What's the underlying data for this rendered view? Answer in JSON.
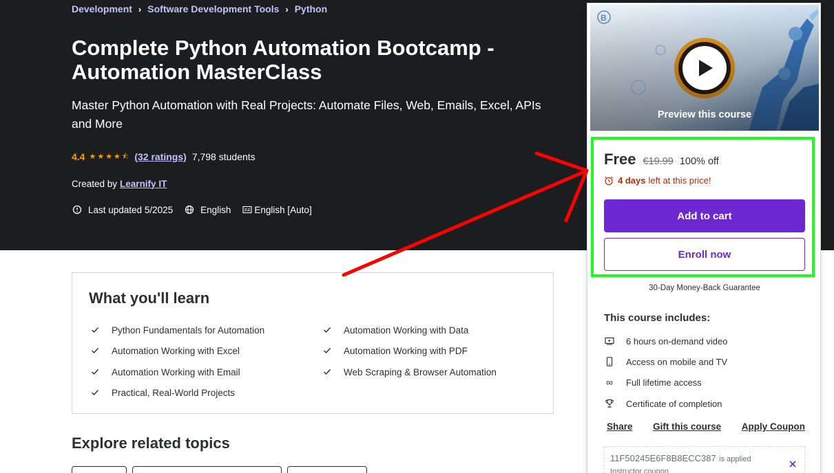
{
  "breadcrumb": [
    "Development",
    "Software Development Tools",
    "Python"
  ],
  "course": {
    "title": "Complete Python Automation Bootcamp - Automation MasterClass",
    "subtitle": "Master Python Automation with Real Projects: Automate Files, Web, Emails, Excel, APIs and More",
    "rating": "4.4",
    "stars_value": 4.4,
    "ratings_link": "(32 ratings)",
    "students": "7,798 students",
    "created_by_label": "Created by",
    "author": "Learnify IT",
    "last_updated": "Last updated 5/2025",
    "language": "English",
    "captions": "English [Auto]"
  },
  "learn": {
    "title": "What you'll learn",
    "items": [
      "Python Fundamentals for Automation",
      "Automation Working with Data",
      "Automation Working with Excel",
      "Automation Working with PDF",
      "Automation Working with Email",
      "Web Scraping & Browser Automation",
      "Practical, Real-World Projects"
    ]
  },
  "explore": {
    "title": "Explore related topics"
  },
  "sidebar": {
    "preview_label": "Preview this course",
    "price_free": "Free",
    "price_original": "€19.99",
    "price_off": "100% off",
    "deadline_bold": "4 days",
    "deadline_rest": "left at this price!",
    "add_to_cart": "Add to cart",
    "enroll_now": "Enroll now",
    "guarantee": "30-Day Money-Back Guarantee",
    "includes_title": "This course includes:",
    "includes": [
      {
        "icon": "video-icon",
        "label": "6 hours on-demand video"
      },
      {
        "icon": "mobile-icon",
        "label": "Access on mobile and TV"
      },
      {
        "icon": "infinity-icon",
        "label": "Full lifetime access"
      },
      {
        "icon": "trophy-icon",
        "label": "Certificate of completion"
      }
    ],
    "links": [
      "Share",
      "Gift this course",
      "Apply Coupon"
    ],
    "coupon_code": "11F50245E6F8B8ECC387",
    "coupon_applied": "is applied",
    "coupon_sub": "Instructor coupon"
  },
  "colors": {
    "hero_bg": "#1c1d1f",
    "accent_purple": "#6d28d2",
    "link_lavender": "#c0c4fc",
    "star_orange": "#f69c08",
    "deadline_red": "#b32d0f",
    "highlight_green": "#1efc1e",
    "annotation_red": "#ff0000"
  }
}
